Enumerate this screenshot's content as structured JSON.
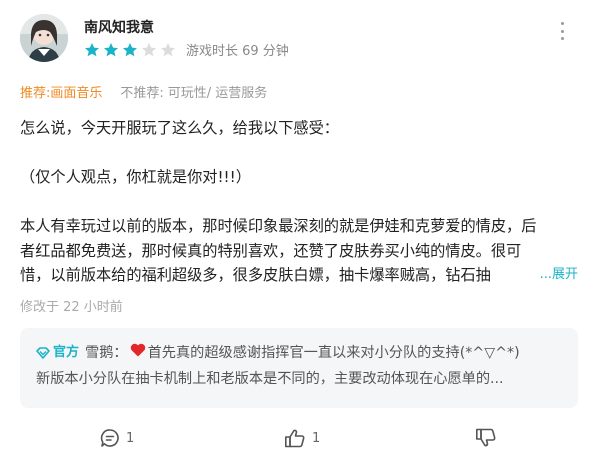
{
  "review": {
    "username": "南风知我意",
    "rating": 3,
    "max_rating": 5,
    "playtime": "游戏时长 69 分钟",
    "tags": {
      "recommend_label": "推荐:",
      "recommend_value": "画面音乐",
      "not_recommend_label": "不推荐:",
      "not_recommend_value": "可玩性/ 运营服务"
    },
    "body_lines": [
      "怎么说，今天开服玩了这么久，给我以下感受：",
      "",
      "（仅个人观点，你杠就是你对!!!）",
      "",
      "本人有幸玩过以前的版本，那时候印象最深刻的就是伊娃和克萝爱的情皮，后",
      "者红品都免费送，那时候真的特别喜欢，还赞了皮肤券买小纯的情皮。很可",
      "惜，以前版本给的福利超级多，很多皮肤白嫖，抽卡爆率贼高，钻石抽"
    ],
    "expand_label": "...展开",
    "edited": "修改于 22 小时前"
  },
  "reply": {
    "badge": "官方",
    "replier": "雪鹅：",
    "line1": "首先真的超级感谢指挥官一直以来对小分队的支持(*^▽^*)",
    "line2": "新版本小分队在抽卡机制上和老版本是不同的，主要改动体现在心愿单的..."
  },
  "footer": {
    "comment_count": "1",
    "like_count": "1"
  },
  "colors": {
    "accent": "#1ab3c8",
    "recommend": "#f08a24",
    "muted": "#999999"
  },
  "icons": [
    "more-options-icon",
    "star-icon",
    "official-badge-icon",
    "heart-emoji-icon",
    "comment-icon",
    "like-icon",
    "dislike-icon"
  ]
}
